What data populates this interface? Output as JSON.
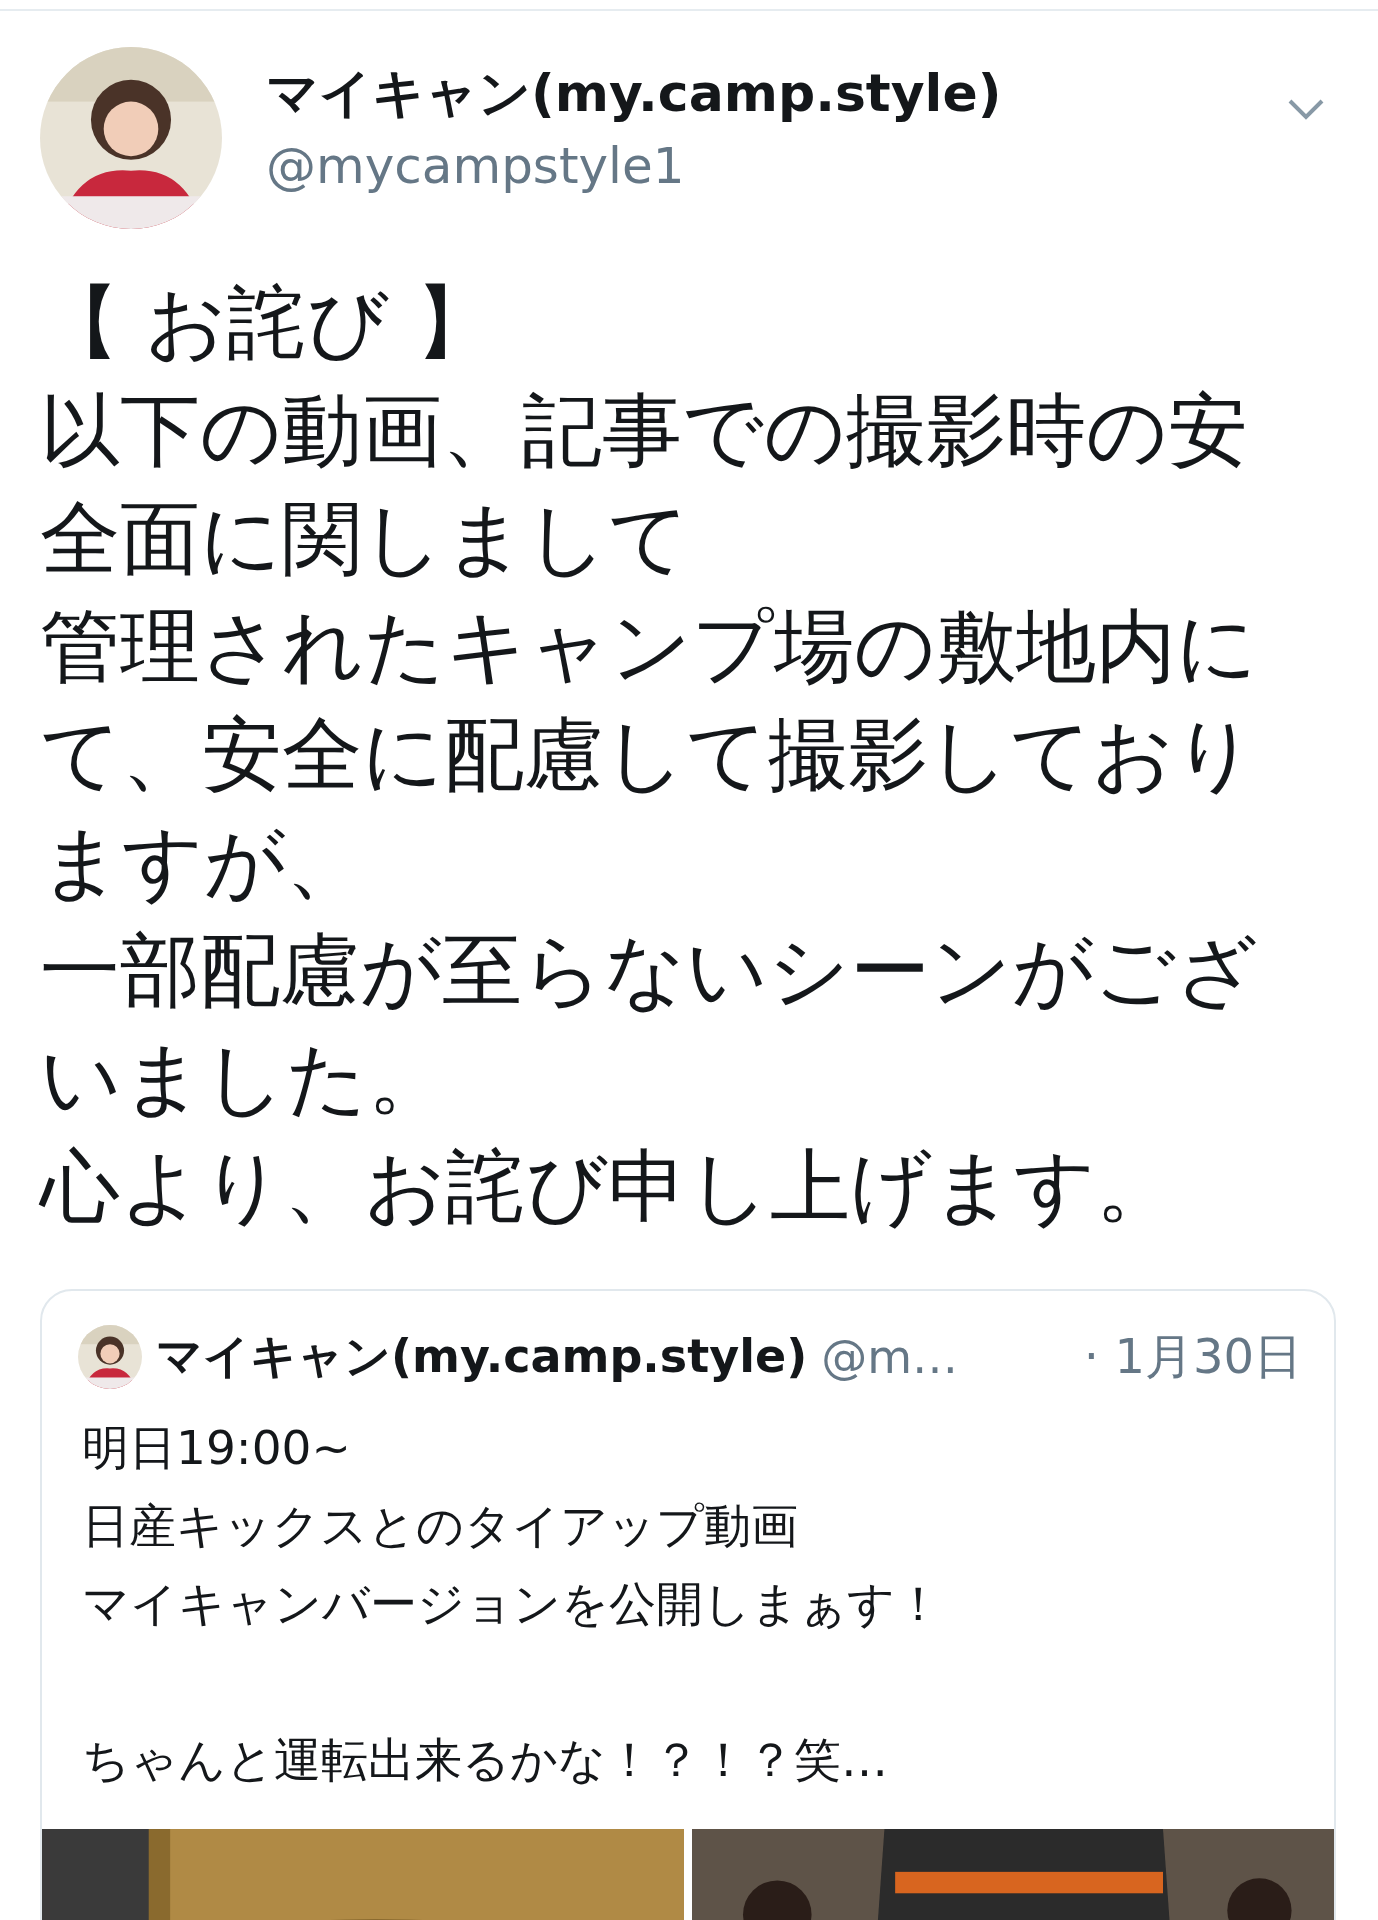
{
  "tweet": {
    "author": {
      "name": "マイキャン(my.camp.style)",
      "handle": "@mycampstyle1"
    },
    "text_lines": [
      "【 お詫び 】",
      "以下の動画、記事での撮影時の安",
      "全面に関しまして",
      "管理されたキャンプ場の敷地内に",
      "て、安全に配慮して撮影しており",
      "ますが、",
      "一部配慮が至らないシーンがござ",
      "いました。",
      "心より、お詫び申し上げます。"
    ],
    "quoted": {
      "author": {
        "name": "マイキャン(my.camp.style)",
        "handle": "@m…"
      },
      "date": "· 1月30日",
      "paragraphs": [
        [
          "明日19:00~",
          "日産キックスとのタイアップ動画",
          "マイキャンバージョンを公開しまぁす！"
        ],
        [
          "ちゃんと運転出来るかな！？！？笑…"
        ]
      ],
      "media": [
        {
          "kind": "picture"
        },
        {
          "kind": "picture"
        }
      ]
    }
  }
}
